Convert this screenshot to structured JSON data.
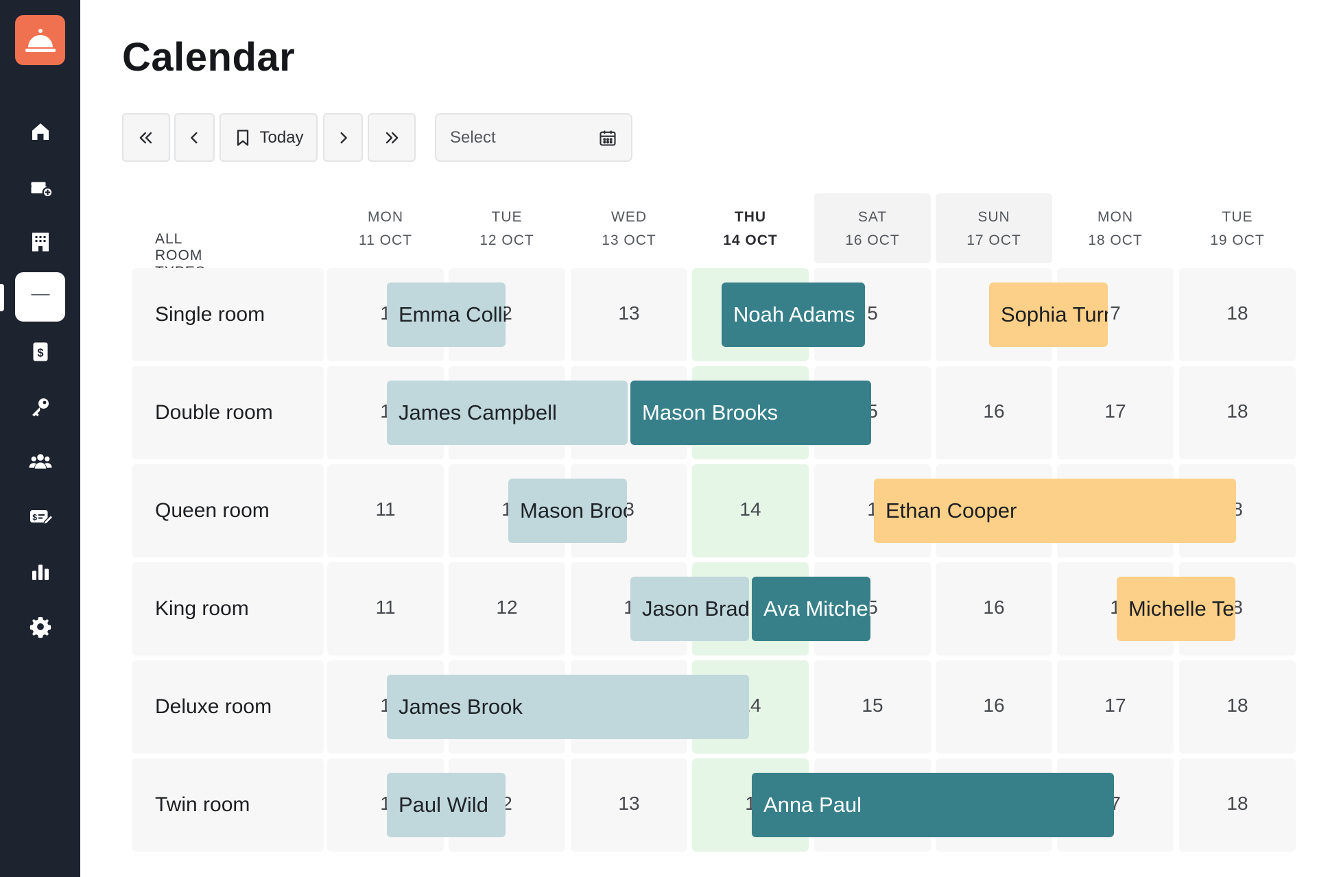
{
  "app": {
    "title": "Calendar"
  },
  "sidebar": {
    "items": [
      {
        "name": "home",
        "icon": "home-icon",
        "active": false
      },
      {
        "name": "new-booking",
        "icon": "bed-plus-icon",
        "active": false
      },
      {
        "name": "hotel",
        "icon": "building-icon",
        "active": false
      },
      {
        "name": "calendar",
        "icon": "calendar-icon",
        "active": true
      },
      {
        "name": "payments",
        "icon": "dollar-doc-icon",
        "active": false
      },
      {
        "name": "keys",
        "icon": "key-icon",
        "active": false
      },
      {
        "name": "guests",
        "icon": "users-icon",
        "active": false
      },
      {
        "name": "billing",
        "icon": "money-edit-icon",
        "active": false
      },
      {
        "name": "reports",
        "icon": "bar-chart-icon",
        "active": false
      },
      {
        "name": "settings",
        "icon": "gear-icon",
        "active": false
      }
    ]
  },
  "toolbar": {
    "today_label": "Today",
    "select_placeholder": "Select"
  },
  "calendar": {
    "room_types_label": "ALL ROOM TYPES",
    "days": [
      {
        "dow": "MON",
        "date": "11 OCT",
        "today": false,
        "weekend": false
      },
      {
        "dow": "TUE",
        "date": "12 OCT",
        "today": false,
        "weekend": false
      },
      {
        "dow": "WED",
        "date": "13 OCT",
        "today": false,
        "weekend": false
      },
      {
        "dow": "THU",
        "date": "14 OCT",
        "today": true,
        "weekend": false
      },
      {
        "dow": "SAT",
        "date": "16 OCT",
        "today": false,
        "weekend": true
      },
      {
        "dow": "SUN",
        "date": "17 OCT",
        "today": false,
        "weekend": true
      },
      {
        "dow": "MON",
        "date": "18 OCT",
        "today": false,
        "weekend": false
      },
      {
        "dow": "TUE",
        "date": "19 OCT",
        "today": false,
        "weekend": false
      }
    ],
    "rooms": [
      {
        "name": "Single room",
        "cells": [
          "1",
          "2",
          "13",
          "",
          "5",
          "1",
          "7",
          "18"
        ],
        "bookings": [
          {
            "guest": "Emma Collins",
            "status": "past",
            "start": 0.5,
            "span": 1
          },
          {
            "guest": "Noah Adams",
            "status": "current",
            "start": 3.25,
            "span": 1.2
          },
          {
            "guest": "Sophia Turner",
            "status": "future",
            "start": 5.45,
            "span": 1
          }
        ]
      },
      {
        "name": "Double room",
        "cells": [
          "1",
          "",
          "",
          "",
          "5",
          "16",
          "17",
          "18"
        ],
        "bookings": [
          {
            "guest": "James Campbell",
            "status": "past",
            "start": 0.5,
            "span": 2
          },
          {
            "guest": "Mason Brooks",
            "status": "current",
            "start": 2.5,
            "span": 2
          }
        ]
      },
      {
        "name": "Queen room",
        "cells": [
          "11",
          "1",
          "3",
          "14",
          "1",
          "",
          "",
          "8"
        ],
        "bookings": [
          {
            "guest": "Mason Brooks",
            "status": "past",
            "start": 1.5,
            "span": 1
          },
          {
            "guest": "Ethan Cooper",
            "status": "future",
            "start": 4.5,
            "span": 3
          }
        ]
      },
      {
        "name": "King room",
        "cells": [
          "11",
          "12",
          "1",
          "",
          "5",
          "16",
          "1",
          "8"
        ],
        "bookings": [
          {
            "guest": "Jason Bradley",
            "status": "past",
            "start": 2.5,
            "span": 1
          },
          {
            "guest": "Ava Mitchell",
            "status": "current",
            "start": 3.5,
            "span": 1
          },
          {
            "guest": "Michelle Terry",
            "status": "future",
            "start": 6.5,
            "span": 1
          }
        ]
      },
      {
        "name": "Deluxe room",
        "cells": [
          "1",
          "",
          "",
          "14",
          "15",
          "16",
          "17",
          "18"
        ],
        "bookings": [
          {
            "guest": "James Brook",
            "status": "past",
            "start": 0.5,
            "span": 3
          }
        ]
      },
      {
        "name": "Twin room",
        "cells": [
          "1",
          "2",
          "13",
          "1",
          "",
          "",
          "7",
          "18"
        ],
        "bookings": [
          {
            "guest": "Paul Wild",
            "status": "past",
            "start": 0.5,
            "span": 1
          },
          {
            "guest": "Anna Paul",
            "status": "current",
            "start": 3.5,
            "span": 3
          }
        ]
      }
    ]
  },
  "colors": {
    "sidebar_bg": "#1d232f",
    "logo_bg": "#f0714f",
    "booking_past": "#c0d7dc",
    "booking_current": "#37808a",
    "booking_future": "#fdd089",
    "today_column": "#e6f6e6"
  }
}
